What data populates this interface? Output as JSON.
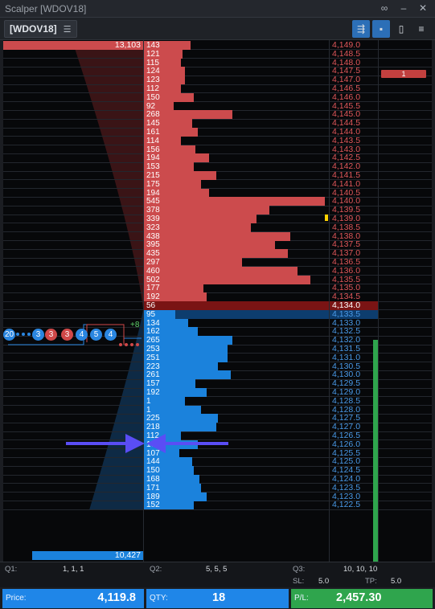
{
  "window": {
    "title": "Scalper [WDOV18]"
  },
  "toolbar": {
    "symbol": "[WDOV18]"
  },
  "ladder": {
    "ask_rows": [
      {
        "qty": "143",
        "price": "4,149.0",
        "bar": 0.25
      },
      {
        "qty": "121",
        "price": "4,148.5",
        "bar": 0.21
      },
      {
        "qty": "115",
        "price": "4,148.0",
        "bar": 0.2
      },
      {
        "qty": "124",
        "price": "4,147.5",
        "bar": 0.22
      },
      {
        "qty": "123",
        "price": "4,147.0",
        "bar": 0.22
      },
      {
        "qty": "112",
        "price": "4,146.5",
        "bar": 0.2
      },
      {
        "qty": "150",
        "price": "4,146.0",
        "bar": 0.27
      },
      {
        "qty": "92",
        "price": "4,145.5",
        "bar": 0.16
      },
      {
        "qty": "268",
        "price": "4,145.0",
        "bar": 0.48
      },
      {
        "qty": "145",
        "price": "4,144.5",
        "bar": 0.26
      },
      {
        "qty": "161",
        "price": "4,144.0",
        "bar": 0.29
      },
      {
        "qty": "114",
        "price": "4,143.5",
        "bar": 0.2
      },
      {
        "qty": "156",
        "price": "4,143.0",
        "bar": 0.28
      },
      {
        "qty": "194",
        "price": "4,142.5",
        "bar": 0.35
      },
      {
        "qty": "153",
        "price": "4,142.0",
        "bar": 0.27
      },
      {
        "qty": "215",
        "price": "4,141.5",
        "bar": 0.39
      },
      {
        "qty": "175",
        "price": "4,141.0",
        "bar": 0.31
      },
      {
        "qty": "194",
        "price": "4,140.5",
        "bar": 0.35
      },
      {
        "qty": "545",
        "price": "4,140.0",
        "bar": 0.98
      },
      {
        "qty": "378",
        "price": "4,139.5",
        "bar": 0.68
      },
      {
        "qty": "339",
        "price": "4,139.0",
        "bar": 0.61
      },
      {
        "qty": "323",
        "price": "4,138.5",
        "bar": 0.58
      },
      {
        "qty": "438",
        "price": "4,138.0",
        "bar": 0.79
      },
      {
        "qty": "395",
        "price": "4,137.5",
        "bar": 0.71
      },
      {
        "qty": "435",
        "price": "4,137.0",
        "bar": 0.78
      },
      {
        "qty": "297",
        "price": "4,136.5",
        "bar": 0.53
      },
      {
        "qty": "460",
        "price": "4,136.0",
        "bar": 0.83
      },
      {
        "qty": "502",
        "price": "4,135.5",
        "bar": 0.9
      },
      {
        "qty": "177",
        "price": "4,135.0",
        "bar": 0.32
      },
      {
        "qty": "192",
        "price": "4,134.5",
        "bar": 0.34
      }
    ],
    "last_row": {
      "qty": "56",
      "price": "4,134.0"
    },
    "bid_rows": [
      {
        "qty": "95",
        "price": "4,133.5",
        "bar": 0.17
      },
      {
        "qty": "134",
        "price": "4,133.0",
        "bar": 0.24
      },
      {
        "qty": "162",
        "price": "4,132.5",
        "bar": 0.29
      },
      {
        "qty": "265",
        "price": "4,132.0",
        "bar": 0.48
      },
      {
        "qty": "253",
        "price": "4,131.5",
        "bar": 0.45
      },
      {
        "qty": "251",
        "price": "4,131.0",
        "bar": 0.45
      },
      {
        "qty": "223",
        "price": "4,130.5",
        "bar": 0.4
      },
      {
        "qty": "261",
        "price": "4,130.0",
        "bar": 0.47
      },
      {
        "qty": "157",
        "price": "4,129.5",
        "bar": 0.28
      },
      {
        "qty": "192",
        "price": "4,129.0",
        "bar": 0.34
      },
      {
        "qty": "1",
        "price": "4,128.5",
        "bar": 0.22
      },
      {
        "qty": "1",
        "price": "4,128.0",
        "bar": 0.31
      },
      {
        "qty": "225",
        "price": "4,127.5",
        "bar": 0.4
      },
      {
        "qty": "218",
        "price": "4,127.0",
        "bar": 0.39
      },
      {
        "qty": "112",
        "price": "4,126.5",
        "bar": 0.2
      },
      {
        "qty": "163",
        "price": "4,126.0",
        "bar": 0.29
      },
      {
        "qty": "107",
        "price": "4,125.5",
        "bar": 0.19
      },
      {
        "qty": "144",
        "price": "4,125.0",
        "bar": 0.26
      },
      {
        "qty": "150",
        "price": "4,124.5",
        "bar": 0.27
      },
      {
        "qty": "168",
        "price": "4,124.0",
        "bar": 0.3
      },
      {
        "qty": "171",
        "price": "4,123.5",
        "bar": 0.31
      },
      {
        "qty": "189",
        "price": "4,123.0",
        "bar": 0.34
      },
      {
        "qty": "152",
        "price": "4,122.5",
        "bar": 0.27
      }
    ],
    "ask_total": "13,103",
    "bid_total": "10,427",
    "working_order": "1",
    "delta_label": "+8",
    "queue_circles": [
      {
        "label": "20",
        "color": "blue"
      },
      {
        "label": "3",
        "color": "blue"
      },
      {
        "label": "3",
        "color": "red"
      },
      {
        "label": "3",
        "color": "red"
      },
      {
        "label": "4",
        "color": "blue"
      },
      {
        "label": "5",
        "color": "blue"
      },
      {
        "label": "4",
        "color": "blue"
      }
    ],
    "colors": {
      "ask": "#cc4b4d",
      "bid": "#1b82dc",
      "position": "#2fa54d",
      "arrow": "#5a4df5"
    }
  },
  "footer": {
    "q1_label": "Q1:",
    "q1_value": "1, 1, 1",
    "q2_label": "Q2:",
    "q2_value": "5, 5, 5",
    "q3_label": "Q3:",
    "q3_value": "10, 10, 10",
    "sl_label": "SL:",
    "sl_value": "5.0",
    "tp_label": "TP:",
    "tp_value": "5.0",
    "price_label": "Price:",
    "price_value": "4,119.8",
    "qty_label": "QTY:",
    "qty_value": "18",
    "pl_label": "P/L:",
    "pl_value": "2,457.30"
  }
}
